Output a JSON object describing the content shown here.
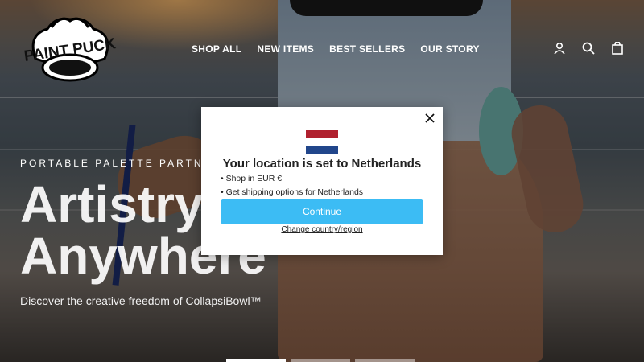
{
  "header": {
    "logo_text": "PAINT PUCK",
    "nav": [
      "SHOP ALL",
      "NEW ITEMS",
      "BEST SELLERS",
      "OUR STORY"
    ],
    "icons": [
      "account-icon",
      "search-icon",
      "cart-icon"
    ]
  },
  "hero": {
    "eyebrow": "PORTABLE PALETTE PARTNER",
    "headline_line1": "Artistry",
    "headline_line2": "Anywhere",
    "subtext": "Discover the creative freedom of CollapsiBowl™",
    "slides": 3,
    "active_slide": 1
  },
  "modal": {
    "title": "Your location is set to Netherlands",
    "items": [
      "Shop in EUR €",
      "Get shipping options for Netherlands"
    ],
    "continue_label": "Continue",
    "change_label": "Change country/region",
    "flag_colors": [
      "#b0212e",
      "#ffffff",
      "#21468b"
    ]
  },
  "colors": {
    "accent": "#3cbcf4"
  }
}
